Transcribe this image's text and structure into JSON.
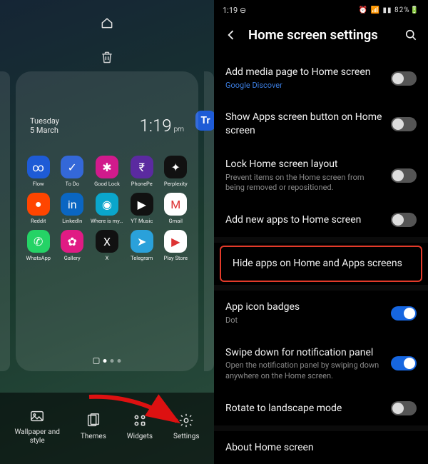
{
  "left": {
    "date_weekday": "Tuesday",
    "date_day": "5 March",
    "clock_time": "1:19",
    "clock_ampm": "pm",
    "edge_app_initial": "Tr",
    "apps": [
      {
        "label": "Flow",
        "bg": "#1e5bd6",
        "glyph": "∞"
      },
      {
        "label": "To Do",
        "bg": "#3468d8",
        "glyph": "✓"
      },
      {
        "label": "Good Lock",
        "bg": "#d11a8c",
        "glyph": "✱"
      },
      {
        "label": "PhonePe",
        "bg": "#5b2aa0",
        "glyph": "₹"
      },
      {
        "label": "Perplexity",
        "bg": "#111",
        "glyph": "✦"
      },
      {
        "label": "Reddit",
        "bg": "#ff4500",
        "glyph": "●"
      },
      {
        "label": "LinkedIn",
        "bg": "#0a66c2",
        "glyph": "in"
      },
      {
        "label": "Where is my...",
        "bg": "#0aa6cc",
        "glyph": "◉"
      },
      {
        "label": "YT Music",
        "bg": "#111",
        "glyph": "▶"
      },
      {
        "label": "Gmail",
        "bg": "#fff",
        "glyph": "M"
      },
      {
        "label": "WhatsApp",
        "bg": "#25d366",
        "glyph": "✆"
      },
      {
        "label": "Gallery",
        "bg": "#e01b84",
        "glyph": "✿"
      },
      {
        "label": "X",
        "bg": "#111",
        "glyph": "X"
      },
      {
        "label": "Telegram",
        "bg": "#2aa1da",
        "glyph": "➤"
      },
      {
        "label": "Play Store",
        "bg": "#fff",
        "glyph": "▶"
      }
    ],
    "bottom": [
      {
        "label": "Wallpaper and\nstyle"
      },
      {
        "label": "Themes"
      },
      {
        "label": "Widgets"
      },
      {
        "label": "Settings"
      }
    ]
  },
  "right": {
    "status_time": "1:19",
    "status_battery": "82%",
    "title": "Home screen settings",
    "rows": [
      {
        "title": "Add media page to Home screen",
        "sub": "Google Discover",
        "subLink": true,
        "toggle": "off"
      },
      {
        "title": "Show Apps screen button on Home screen",
        "toggle": "off"
      },
      {
        "title": "Lock Home screen layout",
        "sub": "Prevent items on the Home screen from being removed or repositioned.",
        "toggle": "off"
      },
      {
        "title": "Add new apps to Home screen",
        "toggle": "off"
      },
      {
        "sep": true
      },
      {
        "title": "Hide apps on Home and Apps screens",
        "highlight": true
      },
      {
        "sep": true
      },
      {
        "title": "App icon badges",
        "sub": "Dot",
        "toggle": "on"
      },
      {
        "title": "Swipe down for notification panel",
        "sub": "Open the notification panel by swiping down anywhere on the Home screen.",
        "toggle": "on"
      },
      {
        "title": "Rotate to landscape mode",
        "toggle": "off"
      },
      {
        "sep": true
      },
      {
        "title": "About Home screen"
      }
    ]
  }
}
